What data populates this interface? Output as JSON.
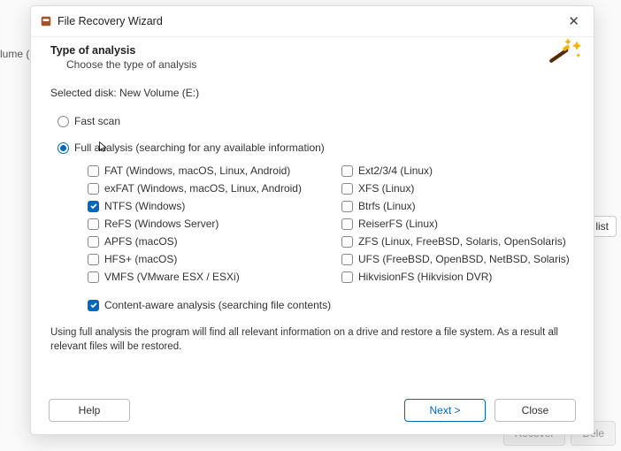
{
  "background": {
    "volume_label": "lume (E:",
    "list_button": "list",
    "recover": "Recover",
    "delete": "Dele"
  },
  "titlebar": {
    "title": "File Recovery Wizard"
  },
  "header": {
    "heading": "Type of analysis",
    "sub": "Choose the type of analysis"
  },
  "selected_disk": "Selected disk: New Volume (E:)",
  "scan": {
    "fast_label": "Fast scan",
    "full_label": "Full analysis (searching for any available information)"
  },
  "fs": {
    "left": [
      "FAT (Windows, macOS, Linux, Android)",
      "exFAT (Windows, macOS, Linux, Android)",
      "NTFS (Windows)",
      "ReFS (Windows Server)",
      "APFS (macOS)",
      "HFS+ (macOS)",
      "VMFS (VMware ESX / ESXi)"
    ],
    "right": [
      "Ext2/3/4 (Linux)",
      "XFS (Linux)",
      "Btrfs (Linux)",
      "ReiserFS (Linux)",
      "ZFS (Linux, FreeBSD, Solaris, OpenSolaris)",
      "UFS (FreeBSD, OpenBSD, NetBSD, Solaris)",
      "HikvisionFS (Hikvision DVR)"
    ]
  },
  "content_aware": "Content-aware analysis (searching file contents)",
  "note": "Using full analysis the program will find all relevant information on a drive and restore a file system. As a result all relevant files will be restored.",
  "buttons": {
    "help": "Help",
    "next": "Next >",
    "close": "Close"
  }
}
